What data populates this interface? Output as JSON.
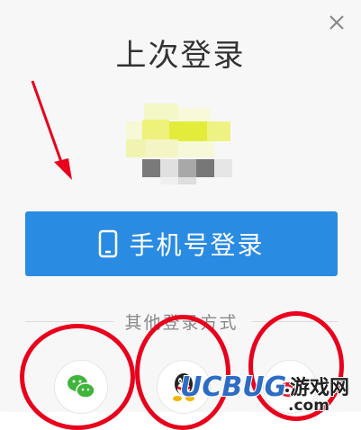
{
  "dialog": {
    "title": "上次登录",
    "close_icon": "close-icon"
  },
  "primary": {
    "phone_login_label": "手机号登录",
    "phone_icon": "mobile-phone-icon",
    "color": "#2a8be2"
  },
  "alternatives": {
    "divider_label": "其他登录方式",
    "items": [
      {
        "icon": "wechat-icon"
      },
      {
        "icon": "qq-icon"
      },
      {
        "icon": "weibo-icon"
      }
    ]
  },
  "annotations": {
    "arrow_color": "#e8001c",
    "circle_color": "#e8001c"
  },
  "watermark": {
    "brand": "UCBUG",
    "suffix": "游戏网",
    "domain": ".com"
  }
}
